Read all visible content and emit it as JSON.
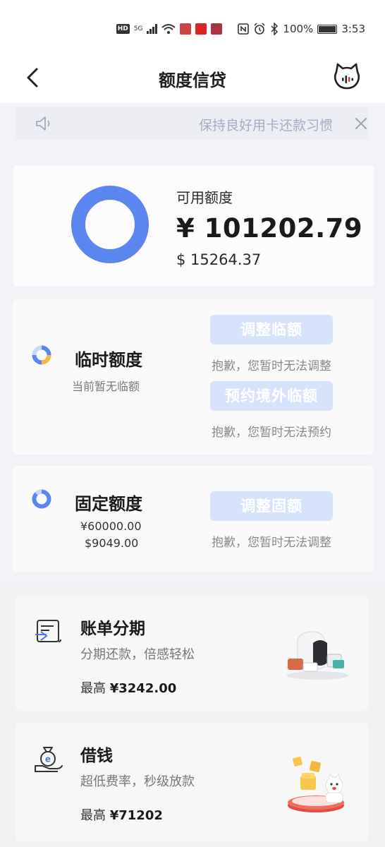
{
  "status_bar": {
    "hd": "HD",
    "network": "5G",
    "battery": "100%",
    "time": "3:53"
  },
  "nav": {
    "title": "额度信贷",
    "back_icon": "chevron-left-icon",
    "service_icon": "cat-service-icon"
  },
  "notice": {
    "text": "保持良好用卡还款习惯"
  },
  "available": {
    "label": "可用额度",
    "rmb": "¥ 101202.79",
    "usd": "$ 15264.37",
    "ring_color": "#5b86f0"
  },
  "temporary": {
    "title": "临时额度",
    "subtitle": "当前暂无临额",
    "adjust_button": "调整临额",
    "adjust_note": "抱歉，您暂时无法调整",
    "book_button": "预约境外临额",
    "book_note": "抱歉，您暂时无法预约"
  },
  "fixed": {
    "title": "固定额度",
    "rmb": "¥60000.00",
    "usd": "$9049.00",
    "adjust_button": "调整固额",
    "adjust_note": "抱歉，您暂时无法调整"
  },
  "bill_installment": {
    "title": "账单分期",
    "subtitle": "分期还款，倍感轻松",
    "max_label": "最高",
    "max_value": "¥3242.00"
  },
  "loan": {
    "title": "借钱",
    "subtitle": "超低费率，秒级放款",
    "max_label": "最高",
    "max_value": "¥71202"
  },
  "colors": {
    "accent": "#5b86f0",
    "button_disabled": "#d7e2fb"
  }
}
